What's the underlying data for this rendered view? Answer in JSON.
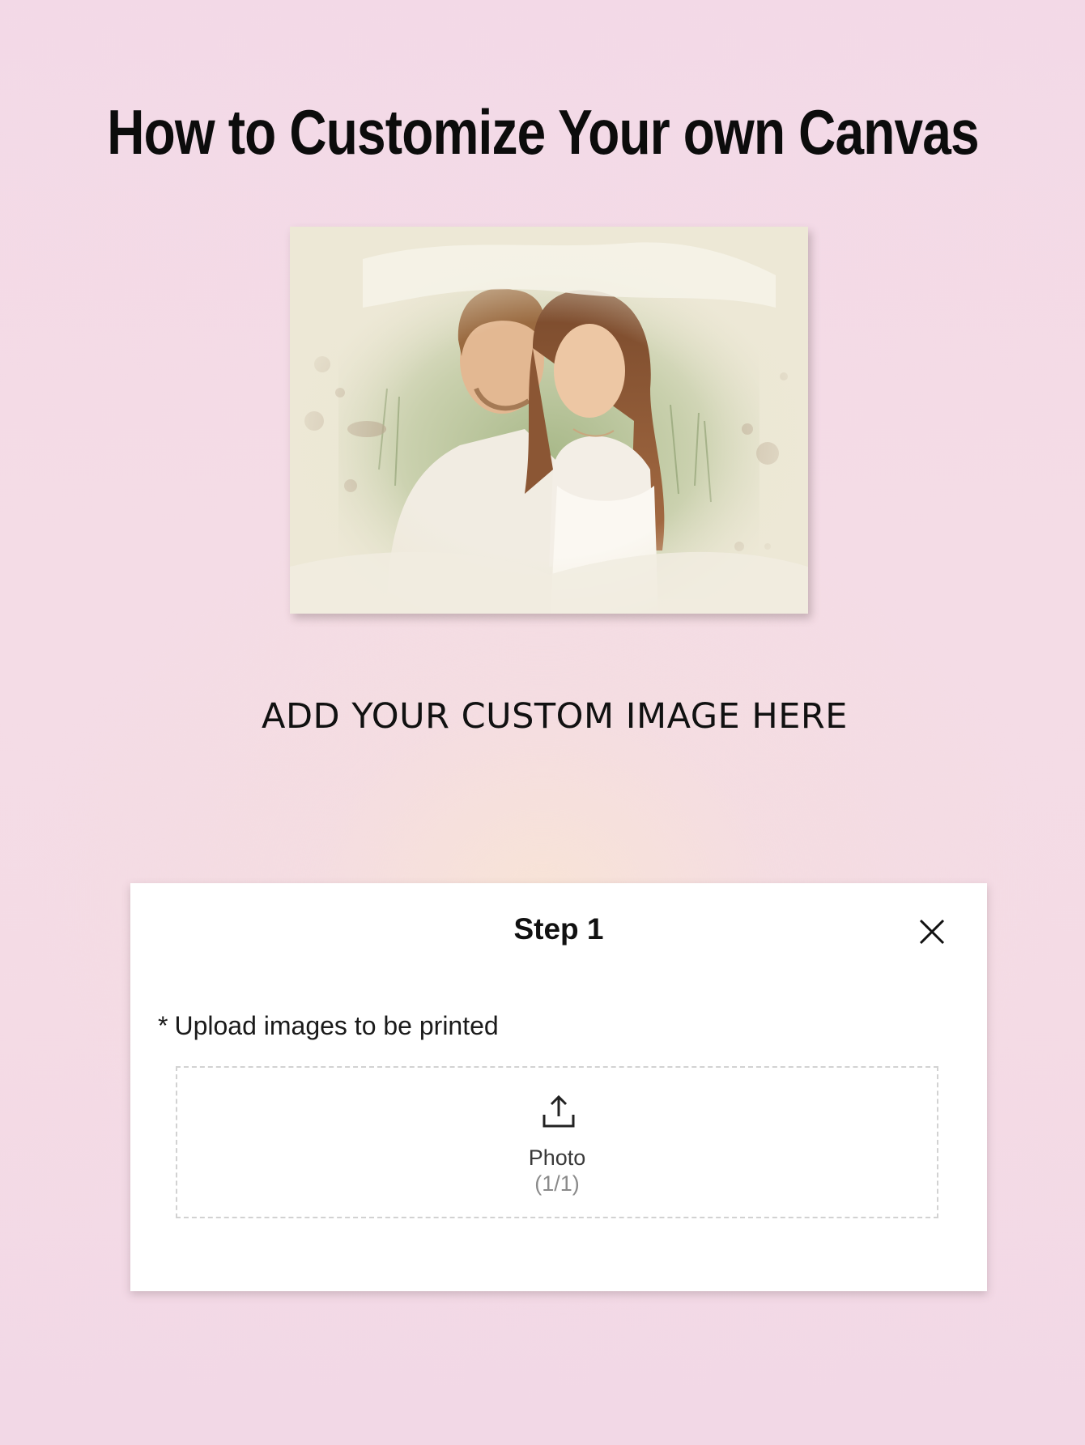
{
  "header": {
    "title": "How to Customize Your own Canvas"
  },
  "preview": {
    "icon": "couple-photo-canvas"
  },
  "cta": {
    "text": "ADD YOUR CUSTOM IMAGE HERE"
  },
  "panel": {
    "title": "Step 1",
    "close_icon": "close-icon",
    "required_marker": "*",
    "upload_label": "Upload images to be printed",
    "dropzone": {
      "icon": "upload-icon",
      "label": "Photo",
      "count": "(1/1)"
    }
  }
}
